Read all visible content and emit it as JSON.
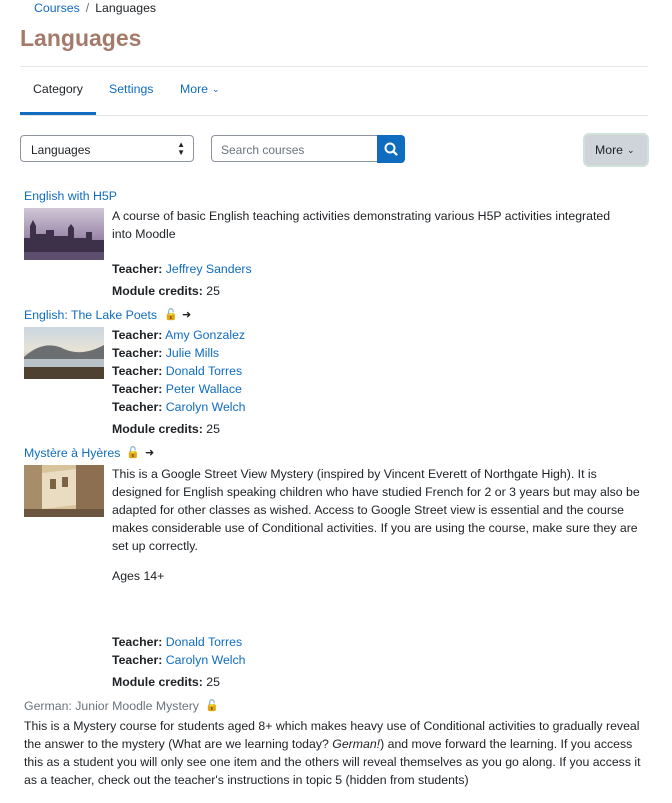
{
  "breadcrumb": {
    "root": "Courses",
    "separator": "/",
    "current": "Languages"
  },
  "page": {
    "title": "Languages"
  },
  "tabs": [
    {
      "label": "Category"
    },
    {
      "label": "Settings"
    },
    {
      "label": "More"
    }
  ],
  "filter": {
    "selected": "Languages",
    "search_placeholder": "Search courses",
    "more_label": "More"
  },
  "labels": {
    "teacher": "Teacher:",
    "module_credits": "Module credits:"
  },
  "courses": [
    {
      "name": "English with H5P",
      "description": "A course of basic English teaching activities demonstrating various H5P activities integrated into Moodle",
      "teachers": [
        "Jeffrey Sanders"
      ],
      "credits": "25"
    },
    {
      "name": "English: The Lake Poets",
      "teachers": [
        "Amy Gonzalez",
        "Julie Mills",
        "Donald Torres",
        "Peter Wallace",
        "Carolyn Welch"
      ],
      "credits": "25"
    },
    {
      "name": "Mystère à Hyères",
      "description": "This is a Google Street View Mystery (inspired by Vincent Everett of Northgate High). It is designed for English speaking children who have studied French for 2 or 3 years but may also be adapted for other classes as wished. Access to Google Street view is essential and the course makes considerable use of Conditional activities. If you are using the course, make sure they are set up correctly.",
      "ages": "Ages 14+",
      "teachers": [
        "Donald Torres",
        "Carolyn Welch"
      ],
      "credits": "25"
    },
    {
      "name": "German: Junior Moodle Mystery",
      "description_before": "This is a Mystery course for students aged 8+ which makes heavy use of Conditional activities to gradually reveal the answer to the mystery (What are we learning today? ",
      "description_em": "German!",
      "description_after": ") and move forward the learning. If you access this as a student you will only see one item and the others will reveal themselves as you go along. If you access it as a teacher, check out the teacher's instructions in topic 5 (hidden from students)"
    }
  ]
}
